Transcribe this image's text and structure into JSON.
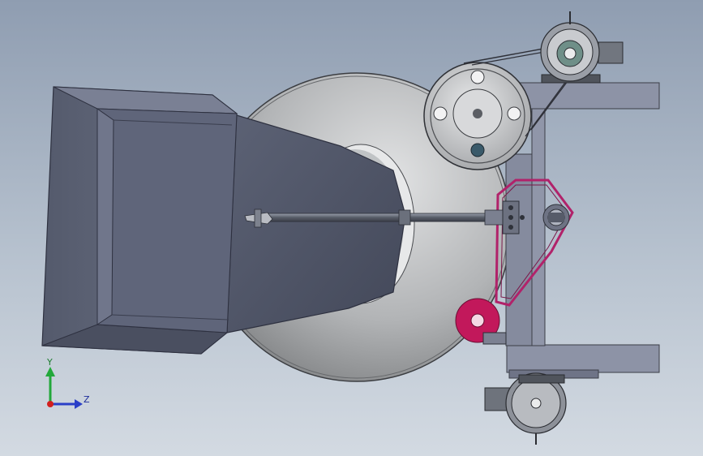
{
  "viewport": {
    "background_top": "#8f9db1",
    "background_bottom": "#d3dae2"
  },
  "triad": {
    "y_label": "Y",
    "z_label": "Z",
    "y_color": "#22a83a",
    "z_color": "#2a3fc8",
    "x_color": "#d21f1f"
  },
  "model": {
    "parts": [
      "hopper",
      "drum",
      "shaft",
      "large-pulley",
      "drive-motor",
      "sprocket",
      "tension-roller",
      "base-frame",
      "secondary-motor"
    ],
    "accent_color": "#c2185b",
    "frame_color": "#8a90a4",
    "hopper_color": "#5e6478",
    "drum_color": "#b9bcbf"
  }
}
